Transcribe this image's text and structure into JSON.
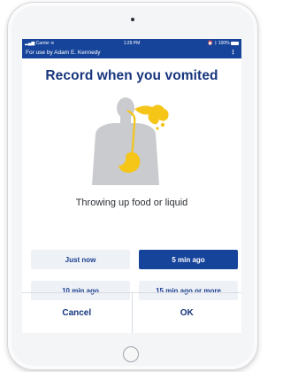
{
  "status_bar": {
    "carrier": "Carrier",
    "time": "1:29 PM",
    "battery": "100%"
  },
  "nav": {
    "title": "For use by Adam E. Kennedy",
    "menu_icon": "more-vertical-icon"
  },
  "page": {
    "title": "Record when you vomited",
    "illustration": "torso-vomiting-illustration",
    "prompt": "Throwing up food or liquid"
  },
  "options": {
    "just_now": "Just now",
    "five_min": "5 min ago",
    "ten_min": "10 min ago",
    "fifteen_min": "15 min ago or more",
    "selected": "5 min ago"
  },
  "footer": {
    "cancel": "Cancel",
    "ok": "OK"
  },
  "colors": {
    "brand": "#17449b",
    "title": "#16357d",
    "option_bg": "#eef1f6",
    "accent_yellow": "#f5c518"
  }
}
